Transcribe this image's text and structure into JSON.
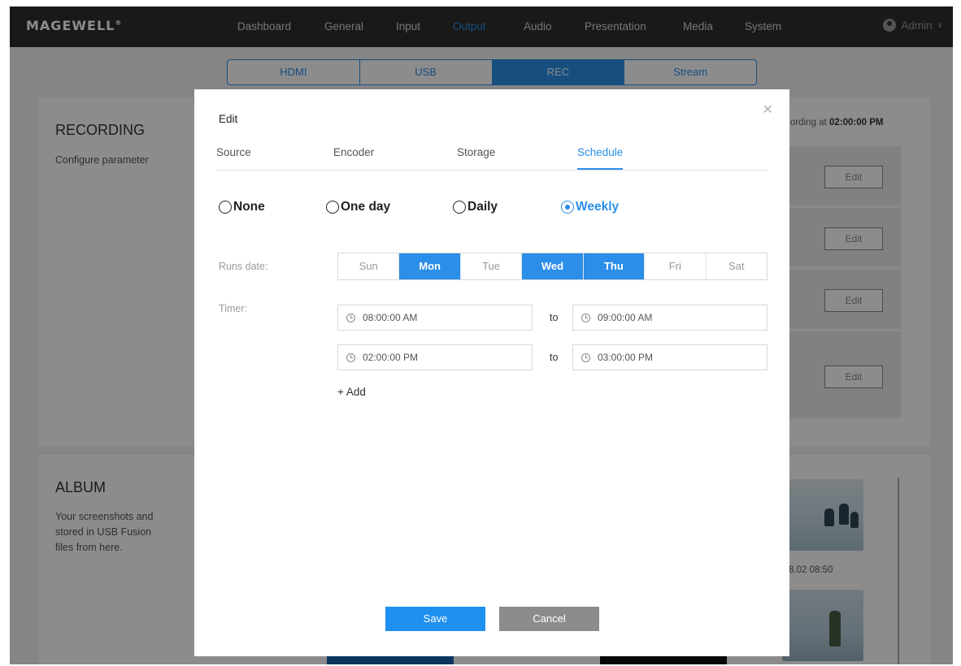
{
  "brand": {
    "logo": "MAGEWELL",
    "reg": "®"
  },
  "nav": {
    "items": [
      "Dashboard",
      "General",
      "Input",
      "Output",
      "Audio",
      "Presentation",
      "Media",
      "System"
    ],
    "active": "Output",
    "user": "Admin"
  },
  "subtabs": {
    "items": [
      "HDMI",
      "USB",
      "REC",
      "Stream"
    ],
    "active": "REC"
  },
  "recording": {
    "title": "RECORDING",
    "description": "Configure parameter",
    "next_prefix": "ording at",
    "next_time": "02:00:00 PM",
    "edit_label": "Edit"
  },
  "album": {
    "title": "ALBUM",
    "description": "Your screenshots and stored in USB Fusion files from here.",
    "thumb_caption": "8.02 08:50"
  },
  "modal": {
    "title": "Edit",
    "tabs": [
      "Source",
      "Encoder",
      "Storage",
      "Schedule"
    ],
    "active_tab": "Schedule",
    "schedule": {
      "options": [
        "None",
        "One day",
        "Daily",
        "Weekly"
      ],
      "selected": "Weekly",
      "runs_date_label": "Runs date:",
      "days": [
        "Sun",
        "Mon",
        "Tue",
        "Wed",
        "Thu",
        "Fri",
        "Sat"
      ],
      "selected_days": [
        "Mon",
        "Wed",
        "Thu"
      ],
      "timer_label": "Timer:",
      "to_label": "to",
      "timers": [
        {
          "start": "08:00:00 AM",
          "end": "09:00:00 AM"
        },
        {
          "start": "02:00:00 PM",
          "end": "03:00:00 PM"
        }
      ],
      "add_label": "+ Add"
    },
    "save_label": "Save",
    "cancel_label": "Cancel"
  },
  "colors": {
    "accent": "#2b8ee8",
    "save": "#1e90f0",
    "cancel": "#8c8c8c",
    "topbar": "#2f2f2f"
  }
}
